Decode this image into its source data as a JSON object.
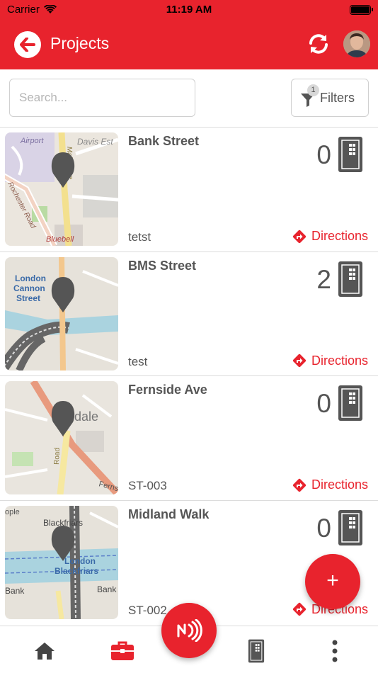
{
  "status_bar": {
    "carrier": "Carrier",
    "time": "11:19 AM",
    "battery_level": 1.0
  },
  "nav": {
    "title": "Projects"
  },
  "search": {
    "placeholder": "Search..."
  },
  "filters": {
    "label": "Filters",
    "badge": "1"
  },
  "colors": {
    "brand_red": "#e8232d",
    "text_gray": "#555555",
    "border": "#d0d0d0"
  },
  "projects": [
    {
      "name": "Bank Street",
      "code": "tetst",
      "count": "0",
      "directions_label": "Directions",
      "map_labels": [
        "Airport",
        "Davis Est",
        "Maidstone",
        "Rochester Road",
        "Bluebell"
      ]
    },
    {
      "name": "BMS Street",
      "code": "test",
      "count": "2",
      "directions_label": "Directions",
      "map_labels": [
        "London",
        "Cannon",
        "Street"
      ]
    },
    {
      "name": "Fernside Ave",
      "code": "ST-003",
      "count": "0",
      "directions_label": "Directions",
      "map_labels": [
        "dale",
        "Road",
        "Ferns"
      ]
    },
    {
      "name": "Midland Walk",
      "code": "ST-002",
      "count": "0",
      "directions_label": "Directions",
      "map_labels": [
        "ople",
        "Blackfriars",
        "London",
        "Blackfriars",
        "Bank",
        "Bank"
      ]
    }
  ],
  "fab": {
    "label": "+"
  },
  "tabs": {
    "icons": [
      "home-icon",
      "briefcase-icon",
      "nfc-icon",
      "cabinet-icon",
      "more-icon"
    ]
  }
}
